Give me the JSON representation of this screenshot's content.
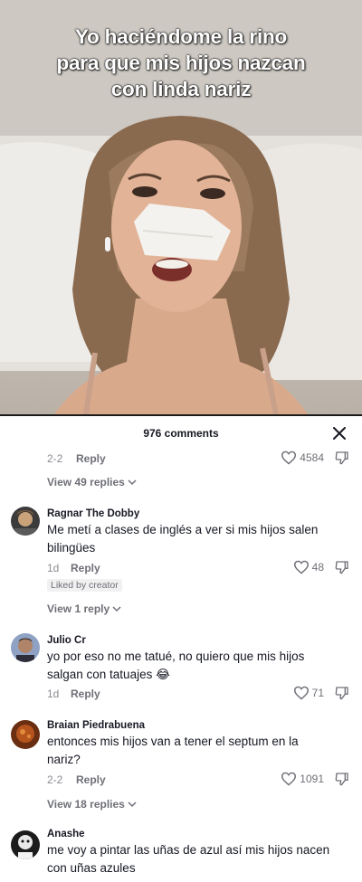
{
  "video": {
    "caption_lines": [
      "Yo haciéndome la rino",
      "para que mis hijos nazcan",
      "con linda nariz"
    ]
  },
  "sheet": {
    "title": "976 comments",
    "close_icon": "close-icon"
  },
  "top_comment_meta": {
    "date": "2-2",
    "reply_label": "Reply",
    "likes": "4584",
    "view_replies": "View 49 replies"
  },
  "comments": [
    {
      "username": "Ragnar The Dobby",
      "text_lines": [
        "Me metí a clases de inglés a ver si mis hijos salen",
        "bilingües"
      ],
      "date": "1d",
      "reply_label": "Reply",
      "likes": "48",
      "badge": "Liked by creator",
      "view_replies": "View 1 reply"
    },
    {
      "username": "Julio Cr",
      "text_lines": [
        "yo por eso no me tatué, no quiero que mis hijos",
        "salgan con tatuajes 😂"
      ],
      "date": "1d",
      "reply_label": "Reply",
      "likes": "71"
    },
    {
      "username": "Braian Piedrabuena",
      "text_lines": [
        "entonces mis hijos van a tener el septum en la",
        "nariz?"
      ],
      "date": "2-2",
      "reply_label": "Reply",
      "likes": "1091",
      "view_replies": "View 18 replies"
    },
    {
      "username": "Anashe",
      "text_lines": [
        "me voy a pintar las uñas de azul así mis hijos nacen",
        "con uñas azules"
      ]
    }
  ],
  "colors": {
    "text_primary": "#161823",
    "text_secondary": "#6f7077",
    "badge_bg": "#f1f1f2"
  }
}
